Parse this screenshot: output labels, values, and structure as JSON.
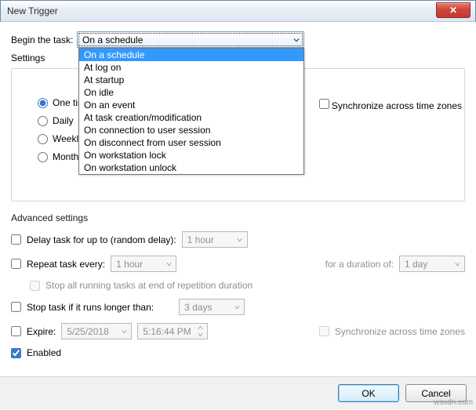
{
  "window": {
    "title": "New Trigger",
    "close_icon": "✕"
  },
  "begin": {
    "label": "Begin the task:",
    "selected": "On a schedule",
    "options": [
      "On a schedule",
      "At log on",
      "At startup",
      "On idle",
      "On an event",
      "At task creation/modification",
      "On connection to user session",
      "On disconnect from user session",
      "On workstation lock",
      "On workstation unlock"
    ]
  },
  "settings": {
    "label": "Settings",
    "schedule_radios": [
      {
        "label": "One time",
        "checked": true
      },
      {
        "label": "Daily",
        "checked": false
      },
      {
        "label": "Weekly",
        "checked": false
      },
      {
        "label": "Monthly",
        "checked": false
      }
    ],
    "sync_label": "Synchronize across time zones"
  },
  "advanced": {
    "heading": "Advanced settings",
    "delay": {
      "label": "Delay task for up to (random delay):",
      "value": "1 hour",
      "checked": false
    },
    "repeat": {
      "label": "Repeat task every:",
      "value": "1 hour",
      "duration_label": "for a duration of:",
      "duration_value": "1 day",
      "checked": false,
      "stop_label": "Stop all running tasks at end of repetition duration"
    },
    "stop": {
      "label": "Stop task if it runs longer than:",
      "value": "3 days",
      "checked": false
    },
    "expire": {
      "label": "Expire:",
      "date": "5/25/2018",
      "time": "5:16:44 PM",
      "sync_label": "Synchronize across time zones",
      "checked": false
    },
    "enabled": {
      "label": "Enabled",
      "checked": true
    }
  },
  "buttons": {
    "ok": "OK",
    "cancel": "Cancel"
  },
  "watermark": "wsxdn.com"
}
